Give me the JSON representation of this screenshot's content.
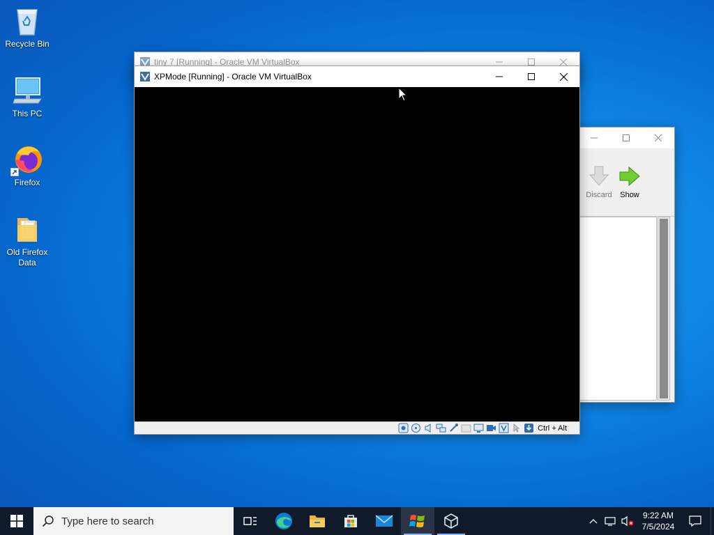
{
  "desktop": {
    "icons": [
      {
        "label": "Recycle Bin"
      },
      {
        "label": "This PC"
      },
      {
        "label": "Firefox"
      },
      {
        "label": "Old Firefox Data"
      }
    ]
  },
  "back_window": {
    "title": "tiny 7 [Running] - Oracle VM VirtualBox"
  },
  "manager_window": {
    "toolbar": {
      "discard_label": "Discard",
      "show_label": "Show"
    }
  },
  "vm_window": {
    "title": "XPMode [Running] - Oracle VM VirtualBox",
    "host_key": "Ctrl + Alt"
  },
  "taskbar": {
    "search_placeholder": "Type here to search",
    "pinned": [
      "task-view",
      "edge",
      "file-explorer",
      "microsoft-store",
      "mail",
      "xp-mode",
      "virtualbox"
    ],
    "time": "9:22 AM",
    "date": "7/5/2024"
  },
  "colors": {
    "desktop_blue": "#0e84e4",
    "taskbar": "#101a2b",
    "vm_screen": "#000000"
  }
}
